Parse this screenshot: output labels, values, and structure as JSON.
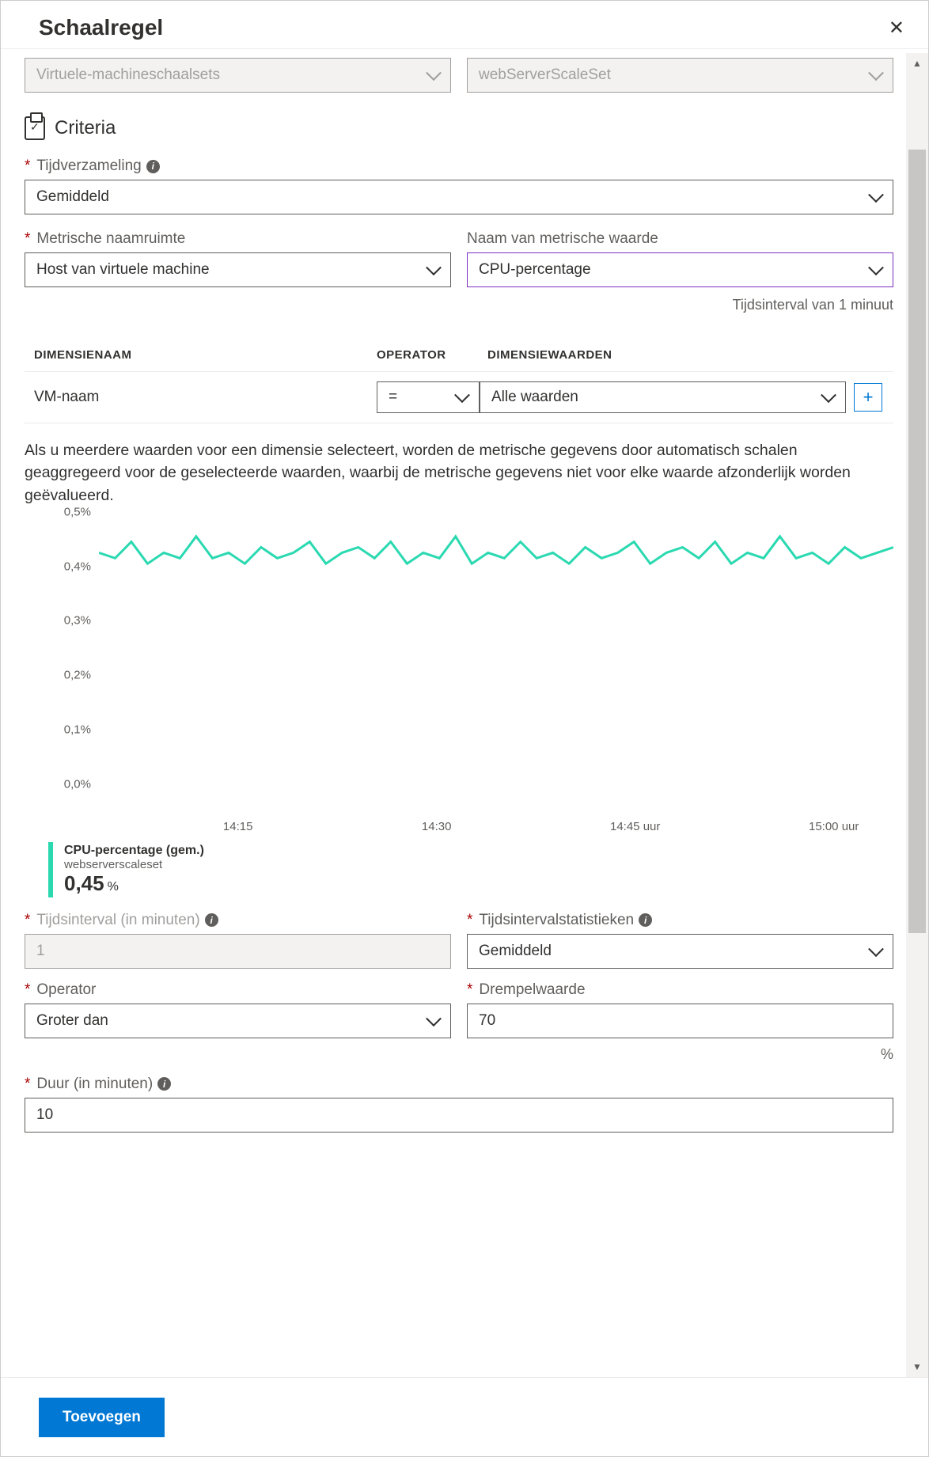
{
  "header": {
    "title": "Schaalregel"
  },
  "topSelects": {
    "resourceType": "Virtuele-machineschaalsets",
    "resource": "webServerScaleSet"
  },
  "criteria": {
    "title": "Criteria",
    "timeAgg": {
      "label": "Tijdverzameling",
      "value": "Gemiddeld"
    },
    "metricNs": {
      "label": "Metrische naamruimte",
      "value": "Host van virtuele machine"
    },
    "metricName": {
      "label": "Naam van metrische waarde",
      "value": "CPU-percentage",
      "sub": "Tijdsinterval van 1 minuut"
    },
    "tableHeaders": {
      "dim": "DIMENSIENAAM",
      "op": "OPERATOR",
      "vals": "DIMENSIEWAARDEN"
    },
    "row": {
      "dim": "VM-naam",
      "op": "=",
      "val": "Alle waarden"
    },
    "help": "Als u meerdere waarden voor een dimensie selecteert, worden de metrische gegevens door automatisch schalen geaggregeerd voor de geselecteerde waarden, waarbij de metrische gegevens niet voor elke waarde afzonderlijk worden geëvalueerd."
  },
  "chart_data": {
    "type": "line",
    "ylabel": "",
    "ylim": [
      0,
      0.5
    ],
    "yticks": [
      "0,0%",
      "0,1%",
      "0,2%",
      "0,3%",
      "0,4%",
      "0,5%"
    ],
    "xticks": [
      "14:15",
      "14:30",
      "14:45 uur",
      "15:00 uur"
    ],
    "series": [
      {
        "name": "CPU-percentage (gem.)",
        "resource": "webserverscaleset",
        "values": [
          0.45,
          0.44,
          0.47,
          0.43,
          0.45,
          0.44,
          0.48,
          0.44,
          0.45,
          0.43,
          0.46,
          0.44,
          0.45,
          0.47,
          0.43,
          0.45,
          0.46,
          0.44,
          0.47,
          0.43,
          0.45,
          0.44,
          0.48,
          0.43,
          0.45,
          0.44,
          0.47,
          0.44,
          0.45,
          0.43,
          0.46,
          0.44,
          0.45,
          0.47,
          0.43,
          0.45,
          0.46,
          0.44,
          0.47,
          0.43,
          0.45,
          0.44,
          0.48,
          0.44,
          0.45,
          0.43,
          0.46,
          0.44,
          0.45,
          0.46
        ],
        "current": "0,45",
        "unit": "%"
      }
    ]
  },
  "fields": {
    "timeGrain": {
      "label": "Tijdsinterval (in minuten)",
      "value": "1"
    },
    "timeStat": {
      "label": "Tijdsintervalstatistieken",
      "value": "Gemiddeld"
    },
    "operator": {
      "label": "Operator",
      "value": "Groter dan"
    },
    "threshold": {
      "label": "Drempelwaarde",
      "value": "70",
      "unit": "%"
    },
    "duration": {
      "label": "Duur (in minuten)",
      "value": "10"
    }
  },
  "footer": {
    "add": "Toevoegen"
  }
}
